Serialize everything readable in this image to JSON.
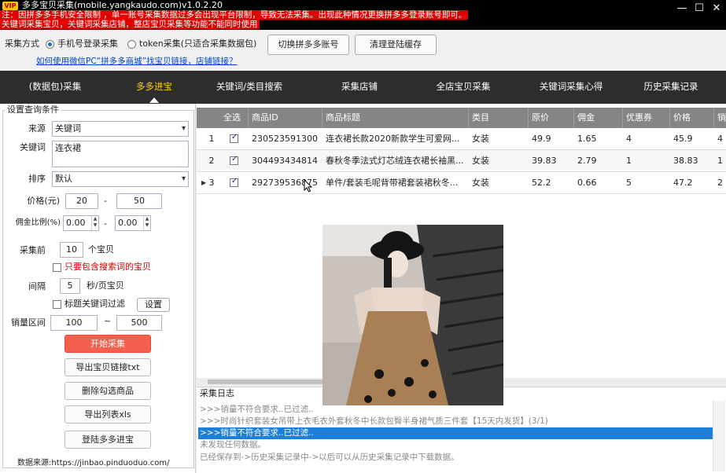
{
  "titlebar": {
    "vip_badge": "VIP",
    "title": "多多宝贝采集(mobile.yangkaudo.com)v1.0.2.20",
    "minimize": "—",
    "maximize": "☐",
    "close": "✕",
    "warning1": "注：因拼多多手机安全限制 ，单一账号采集数据过多会出现平台限制，导致无法采集。出现此种情况更换拼多多登录账号即可。",
    "warning2": "关键词采集宝贝，关键词采集店铺，整店宝贝采集等功能不能同时使用"
  },
  "options": {
    "mode_label": "采集方式",
    "radio_phone": "手机号登录采集",
    "radio_token": "token采集(只适合采集数据包)",
    "switch_account": "切换拼多多账号",
    "clear_cache": "清理登陆缓存",
    "help_link": "如何使用微信PC“拼多多商城”找宝贝链接，店铺链接？"
  },
  "nav": {
    "tabs": [
      "(数据包)采集",
      "多多进宝",
      "关键词/类目搜索",
      "采集店铺",
      "全店宝贝采集",
      "关键词采集心得",
      "历史采集记录"
    ],
    "active_index": 1
  },
  "form": {
    "group_title": "设置查询条件",
    "source_label": "来源",
    "source_value": "关键词",
    "keyword_label": "关键词",
    "keyword_value": "连衣裙",
    "sort_label": "排序",
    "sort_value": "默认",
    "price_label": "价格(元)",
    "price_min": "20",
    "price_max": "50",
    "dash": "-",
    "commission_label": "佣金比例(%)",
    "commission_min": "0.00",
    "commission_max": "0.00",
    "collect_first_label": "采集前",
    "collect_first_value": "10",
    "collect_first_unit": "个宝贝",
    "contain_keyword": "只要包含搜索词的宝贝",
    "interval_label": "间隔",
    "interval_value": "5",
    "interval_unit": "秒/页宝贝",
    "title_filter": "标题关键词过滤",
    "settings_button": "设置",
    "sales_label": "销量区间",
    "sales_min": "100",
    "sales_tilde": "~",
    "sales_max": "500"
  },
  "actions": {
    "start": "开始采集",
    "export_links": "导出宝贝链接txt",
    "delete_checked": "删除勾选商品",
    "export_xls": "导出列表xls",
    "login_jinbao": "登陆多多进宝",
    "data_source": "数据来源:https://jinbao.pinduoduo.com/"
  },
  "table": {
    "headers": [
      "全选",
      "商品ID",
      "商品标题",
      "类目",
      "原价",
      "佣金",
      "优惠券",
      "价格",
      "销"
    ],
    "rows": [
      {
        "num": "1",
        "id": "230523591300",
        "title": "连衣裙长款2020新款学生可爱网...",
        "category": "女装",
        "orig": "49.9",
        "commission": "1.65",
        "coupon": "4",
        "price": "45.9",
        "sales": "4"
      },
      {
        "num": "2",
        "id": "304493434814",
        "title": "春秋冬季法式灯芯绒连衣裙长袖黑...",
        "category": "女装",
        "orig": "39.83",
        "commission": "2.79",
        "coupon": "1",
        "price": "38.83",
        "sales": "1"
      },
      {
        "num": "3",
        "id": "292739536875",
        "title": "单件/套装毛呢背带裙套装裙秋冬...",
        "category": "女装",
        "orig": "52.2",
        "commission": "0.66",
        "coupon": "5",
        "price": "47.2",
        "sales": "2"
      }
    ],
    "row_marker": "▶"
  },
  "log": {
    "title": "采集日志",
    "lines": [
      ">>>销量不符合要求..已过滤..",
      ">>>时尚针织套装女吊带上衣毛衣外套秋冬中长款包臀半身裙气质三件套【15天内发货】(3/1)",
      ">>>销量不符合要求..已过滤..",
      "未发现任何数据。",
      "已经保存到->历史采集记录中->以后可以从历史采集记录中下载数据。"
    ],
    "selected_index": 2
  },
  "colors": {
    "nav_bg": "#2d2d2d",
    "active_tab": "#ffd400",
    "warning_bg": "#e00000",
    "start_button": "#f4604e",
    "table_header": "#858585",
    "log_selected": "#1e7fd8"
  }
}
